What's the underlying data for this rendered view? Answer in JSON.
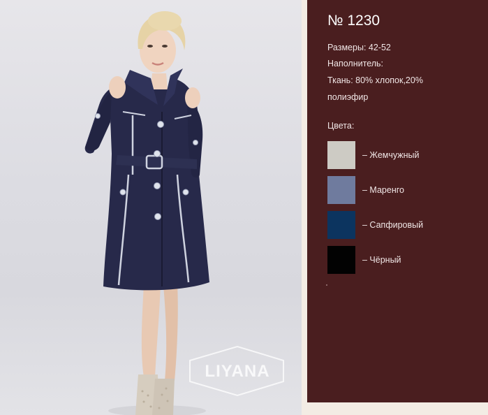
{
  "product": {
    "title": "№ 1230",
    "sizes": "Размеры: 42-52",
    "filler": "Наполнитель:",
    "fabric_line1": "Ткань: 80% хлопок,20%",
    "fabric_line2": "полиэфир"
  },
  "colors": {
    "heading": "Цвета:",
    "items": [
      {
        "label": "– Жемчужный",
        "hex": "#cdcbc4"
      },
      {
        "label": "– Маренго",
        "hex": "#6f7b9e"
      },
      {
        "label": "– Сапфировый",
        "hex": "#0c345f"
      },
      {
        "label": "– Чёрный",
        "hex": "#020202"
      }
    ]
  },
  "photo": {
    "watermark": "LIYANA"
  },
  "theme": {
    "panel_bg": "#4a1e1f",
    "page_bg": "#f3ece4"
  }
}
